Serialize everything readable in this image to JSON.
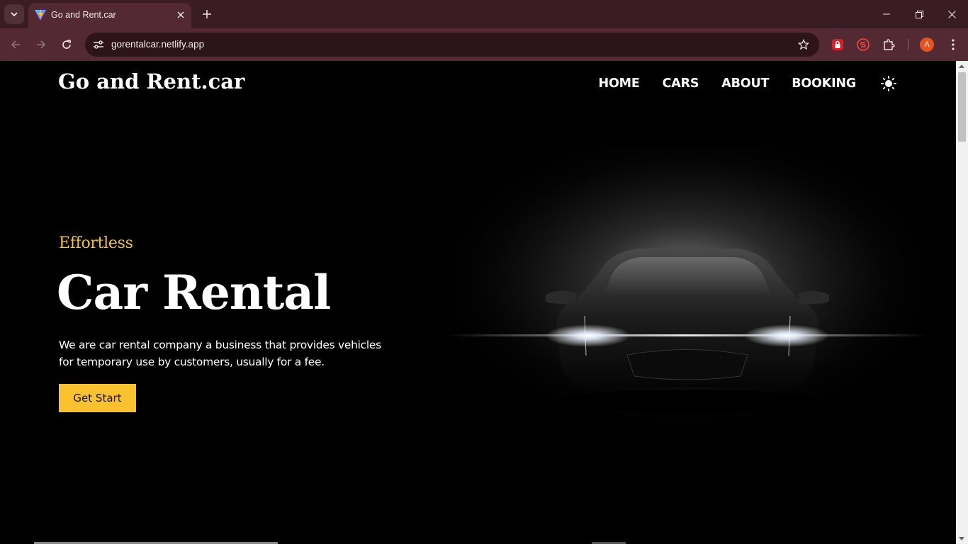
{
  "browser": {
    "tab": {
      "title": "Go and Rent.car"
    },
    "omnibox": {
      "url": "gorentalcar.netlify.app"
    },
    "profile_initial": "A",
    "icons": {
      "tab_search": "chevron-down-icon",
      "favicon": "vite-logo-icon",
      "tab_close": "close-icon",
      "new_tab": "plus-icon",
      "minimize": "minimize-icon",
      "restore": "restore-icon",
      "close_window": "close-icon",
      "back": "arrow-left-icon",
      "forward": "arrow-right-icon",
      "reload": "reload-icon",
      "site_info": "tune-icon",
      "bookmark": "star-icon",
      "extension_1": "lock-extension-icon",
      "extension_2": "shield-s-extension-icon",
      "extensions": "puzzle-icon",
      "menu": "more-vertical-icon"
    }
  },
  "page": {
    "brand": "Go and Rent.car",
    "nav": [
      "HOME",
      "CARS",
      "ABOUT",
      "BOOKING"
    ],
    "theme_icon": "sun-icon",
    "hero": {
      "eyebrow": "Effortless",
      "headline": "Car Rental",
      "description": "We are car rental company a business that provides vehicles for temporary use by customers, usually for a fee.",
      "cta": "Get Start"
    },
    "colors": {
      "accent": "#f9c22e",
      "background": "#000000",
      "text": "#ffffff"
    }
  }
}
